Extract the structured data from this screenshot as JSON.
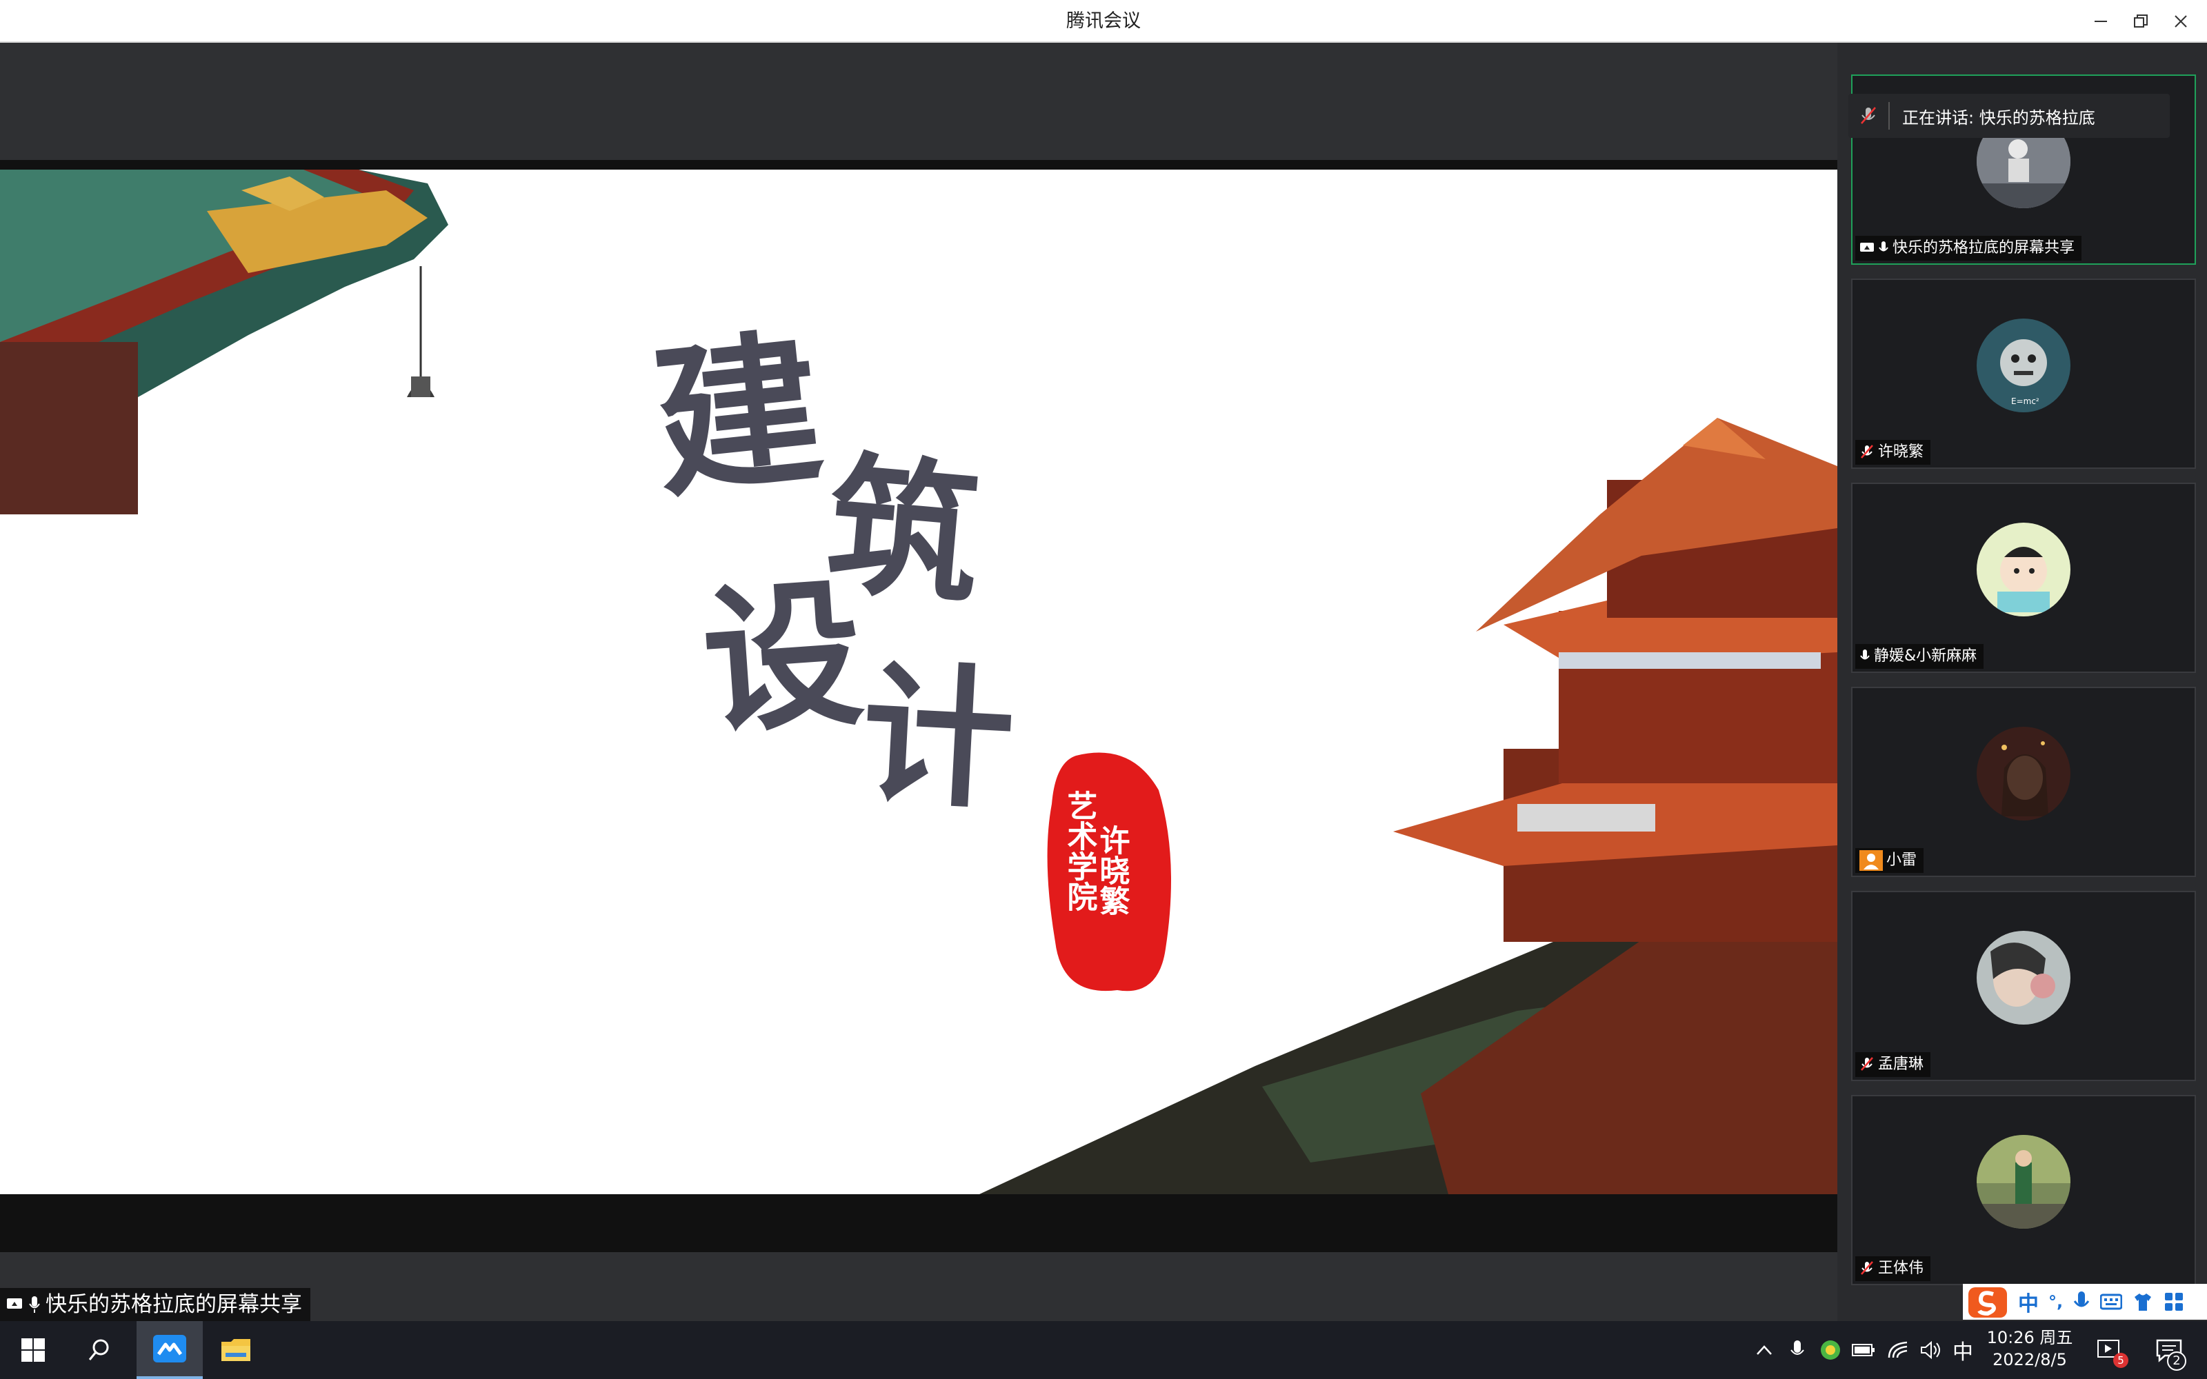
{
  "window": {
    "title": "腾讯会议"
  },
  "slide": {
    "calligraphy_lines": [
      "建",
      "筑",
      "设",
      "计"
    ],
    "seal_text_col1": "许晓繁",
    "seal_text_col2": "艺术学院"
  },
  "share_label": "快乐的苏格拉底的屏幕共享",
  "speaking": {
    "label": "正在讲话: 快乐的苏格拉底"
  },
  "participants": [
    {
      "name": "快乐的苏格拉底的屏幕共享",
      "mic": "on",
      "sharing": true
    },
    {
      "name": "许晓繁",
      "mic": "off"
    },
    {
      "name": "静媛&小新麻麻",
      "mic": "on"
    },
    {
      "name": "小雷",
      "mic": "none"
    },
    {
      "name": "孟唐琳",
      "mic": "off"
    },
    {
      "name": "王体伟",
      "mic": "off"
    }
  ],
  "ime": {
    "lang": "中",
    "punct": "°,"
  },
  "taskbar": {
    "tray_lang": "中",
    "clock_time": "10:26 周五",
    "clock_date": "2022/8/5",
    "notif_badge": "5",
    "action_center_count": "2"
  },
  "colors": {
    "accent_green": "#1fa15a",
    "seal_red": "#e21b1b",
    "ink": "#4a4a58"
  }
}
